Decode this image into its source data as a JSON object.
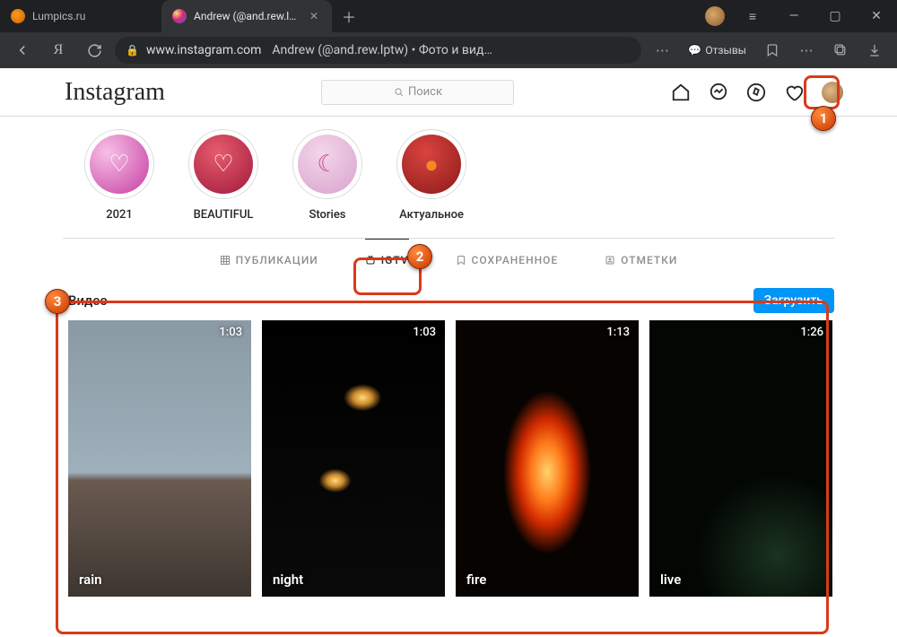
{
  "browser": {
    "tabs": [
      {
        "title": "Lumpics.ru",
        "active": false
      },
      {
        "title": "Andrew (@and.rew.lptw",
        "active": true
      }
    ],
    "url_domain": "www.instagram.com",
    "url_title": "Andrew (@and.rew.lptw) • Фото и вид…",
    "reviews_label": "Отзывы"
  },
  "instagram": {
    "logo": "Instagram",
    "search_placeholder": "Поиск",
    "highlights": [
      {
        "label": "2021",
        "bg": "radial-gradient(circle at 30% 30%,#f6c0e6,#c73ca1)",
        "icon": "♡",
        "iconColor": "#fff"
      },
      {
        "label": "BEAUTIFUL",
        "bg": "radial-gradient(circle at 40% 30%,#e65b6d,#a01a3b)",
        "icon": "♡",
        "iconColor": "#fff"
      },
      {
        "label": "Stories",
        "bg": "radial-gradient(circle at 40% 30%,#f4d6e8,#d8a2cf)",
        "icon": "☾",
        "iconColor": "#c54b97"
      },
      {
        "label": "Актуальное",
        "bg": "radial-gradient(circle at 40% 30%,#d9443f,#8c1a19)",
        "icon": "●",
        "iconColor": "#f28a1f"
      }
    ],
    "tabs": [
      {
        "label": "ПУБЛИКАЦИИ",
        "active": false
      },
      {
        "label": "IGTV",
        "active": true
      },
      {
        "label": "СОХРАНЕННОЕ",
        "active": false
      },
      {
        "label": "ОТМЕТКИ",
        "active": false
      }
    ],
    "section_title": "Видео",
    "upload_label": "Загрузить",
    "videos": [
      {
        "title": "rain",
        "duration": "1:03",
        "bg": "linear-gradient(#8a9aa5 0%,#9eb0bb 55%,#6a5a50 58%,#3d3630 100%)"
      },
      {
        "title": "night",
        "duration": "1:03",
        "bg": "radial-gradient(ellipse 35px 25px at 55% 28%,#ffdc7a,#cc8a2d 30%,transparent 60%),radial-gradient(ellipse 30px 22px at 40% 58%,#ffdc7a,#cc8a2d 30%,transparent 60%),linear-gradient(#000,#0a0a0a)"
      },
      {
        "title": "fire",
        "duration": "1:13",
        "bg": "radial-gradient(ellipse 70px 130px at 50% 55%,#ffd36b 0%,#ff7a1a 25%,#d12a00 45%,transparent 70%),#070301"
      },
      {
        "title": "live",
        "duration": "1:26",
        "bg": "radial-gradient(circle at 70% 85%,#1a3320,transparent 30%),#030703"
      }
    ]
  }
}
